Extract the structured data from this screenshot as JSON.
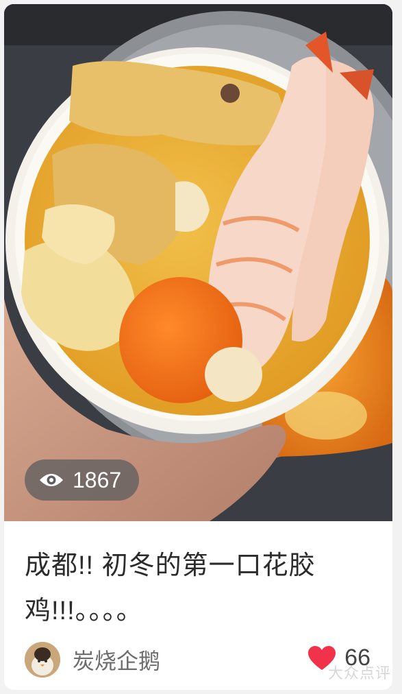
{
  "post": {
    "view_count": "1867",
    "title": "成都!! 初冬的第一口花胶鸡!!!。。。。",
    "author_name": "炭烧企鹅",
    "like_count": "66"
  },
  "icons": {
    "views": "eye-icon",
    "likes": "heart-icon",
    "avatar": "penguin-avatar"
  },
  "colors": {
    "heart": "#f0334b",
    "title_text": "#2b2b2b",
    "author_text": "#6d6d6d"
  },
  "watermark": "大众点评"
}
